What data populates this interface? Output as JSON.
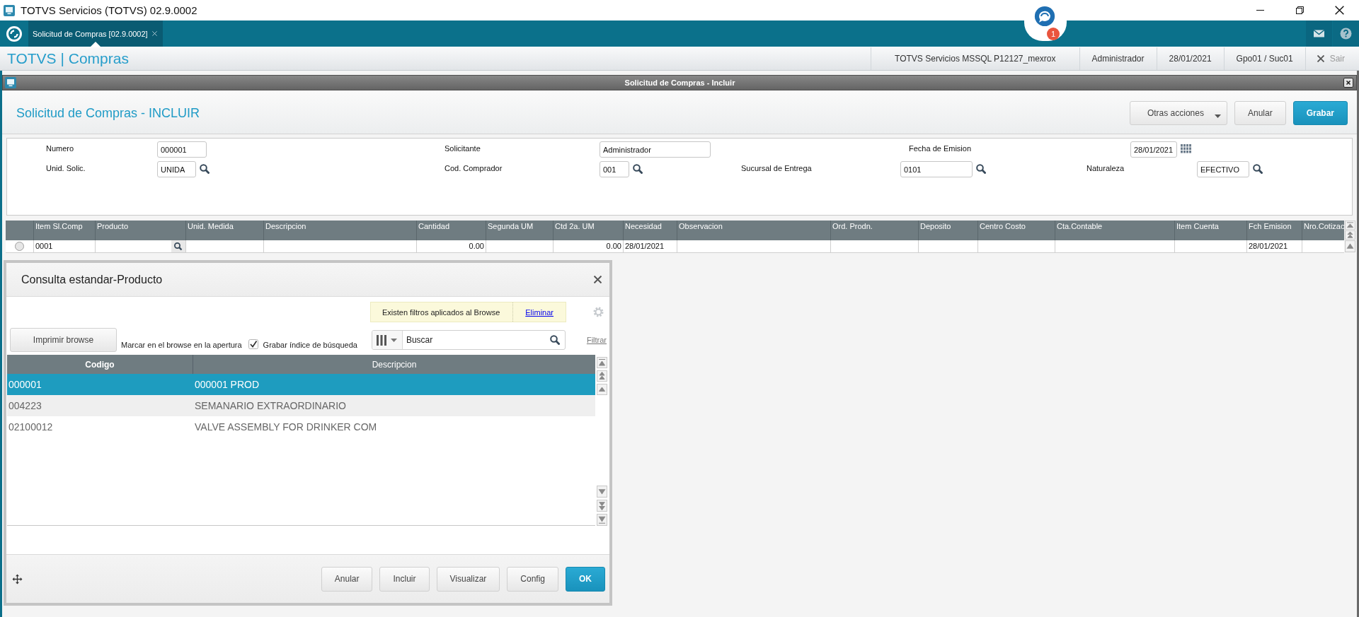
{
  "window": {
    "title": "TOTVS Servicios (TOTVS) 02.9.0002"
  },
  "top_bar": {
    "tabs": [
      {
        "label": "Solicitud de Compras [02.9.0002]",
        "selected": true
      }
    ],
    "notifications": {
      "count": "1"
    }
  },
  "app_header": {
    "title": "TOTVS | Compras",
    "info": [
      "TOTVS Servicios MSSQL P12127_mexrox",
      "Administrador",
      "28/01/2021",
      "Gpo01 / Suc01"
    ],
    "exit": "Sair"
  },
  "inner_window": {
    "title": "Solicitud de Compras - Incluir"
  },
  "page": {
    "title": "Solicitud de Compras - INCLUIR",
    "actions": [
      {
        "label": "Otras acciones",
        "kind": "menu"
      },
      {
        "label": "Anular",
        "kind": "secondary"
      },
      {
        "label": "Grabar",
        "kind": "primary"
      }
    ]
  },
  "form": {
    "rows": [
      [
        {
          "label": "Numero",
          "value": "000001",
          "kind": "text"
        },
        {
          "label": "Solicitante",
          "value": "Administrador",
          "kind": "text"
        },
        {
          "label": "Fecha de Emision",
          "value": "28/01/2021",
          "kind": "date"
        }
      ],
      [
        {
          "label": "Unid. Solic.",
          "value": "UNIDA",
          "kind": "lookup"
        },
        {
          "label": "Cod. Comprador",
          "value": "001",
          "kind": "lookup"
        },
        {
          "label": "Sucursal de Entrega",
          "value": "0101",
          "kind": "lookup"
        },
        {
          "label": "Naturaleza",
          "value": "EFECTIVO",
          "kind": "lookup"
        }
      ]
    ]
  },
  "items_table": {
    "columns": [
      {
        "label": "Item Sl.Comp",
        "kind": "text"
      },
      {
        "label": "Producto",
        "kind": "lookup"
      },
      {
        "label": "Unid. Medida",
        "kind": "text"
      },
      {
        "label": "Descripcion",
        "kind": "text"
      },
      {
        "label": "Cantidad",
        "kind": "number"
      },
      {
        "label": "Segunda UM",
        "kind": "text"
      },
      {
        "label": "Ctd 2a. UM",
        "kind": "number"
      },
      {
        "label": "Necesidad",
        "kind": "text"
      },
      {
        "label": "Observacion",
        "kind": "text"
      },
      {
        "label": "Ord. Prodn.",
        "kind": "text"
      },
      {
        "label": "Deposito",
        "kind": "text"
      },
      {
        "label": "Centro Costo",
        "kind": "text"
      },
      {
        "label": "Cta.Contable",
        "kind": "text"
      },
      {
        "label": "Item Cuenta",
        "kind": "text"
      },
      {
        "label": "Fch Emision",
        "kind": "text"
      },
      {
        "label": "Nro.Cotizac",
        "kind": "text"
      }
    ],
    "rows": [
      {
        "selected": false,
        "cells": [
          "0001",
          null,
          null,
          null,
          "0.00",
          null,
          "0.00",
          "28/01/2021",
          null,
          null,
          null,
          null,
          null,
          null,
          "28/01/2021",
          null
        ]
      }
    ]
  },
  "lookup_dialog": {
    "title": "Consulta estandar-Producto",
    "filter_notice": {
      "text": "Existen filtros aplicados al Browse",
      "link": "Eliminar"
    },
    "print_button": "Imprimir browse",
    "open_mark_label": "Marcar en el browse en la apertura",
    "save_index": {
      "label": "Grabar índice de búsqueda",
      "checked": true
    },
    "search": {
      "placeholder": "Buscar"
    },
    "filter_link": "Filtrar",
    "browse": {
      "columns": [
        {
          "label": "Codigo",
          "sorted": true
        },
        {
          "label": "Descripcion",
          "sorted": false
        }
      ],
      "rows": [
        {
          "selected": true,
          "cells": [
            "000001",
            "000001 PROD"
          ]
        },
        {
          "selected": false,
          "cells": [
            "004223",
            "SEMANARIO EXTRAORDINARIO"
          ]
        },
        {
          "selected": false,
          "cells": [
            "02100012",
            "VALVE ASSEMBLY FOR DRINKER COM"
          ]
        }
      ]
    },
    "buttons": [
      {
        "label": "Anular",
        "kind": "secondary"
      },
      {
        "label": "Incluir",
        "kind": "secondary"
      },
      {
        "label": "Visualizar",
        "kind": "secondary"
      },
      {
        "label": "Config",
        "kind": "secondary"
      },
      {
        "label": "OK",
        "kind": "primary"
      }
    ]
  }
}
